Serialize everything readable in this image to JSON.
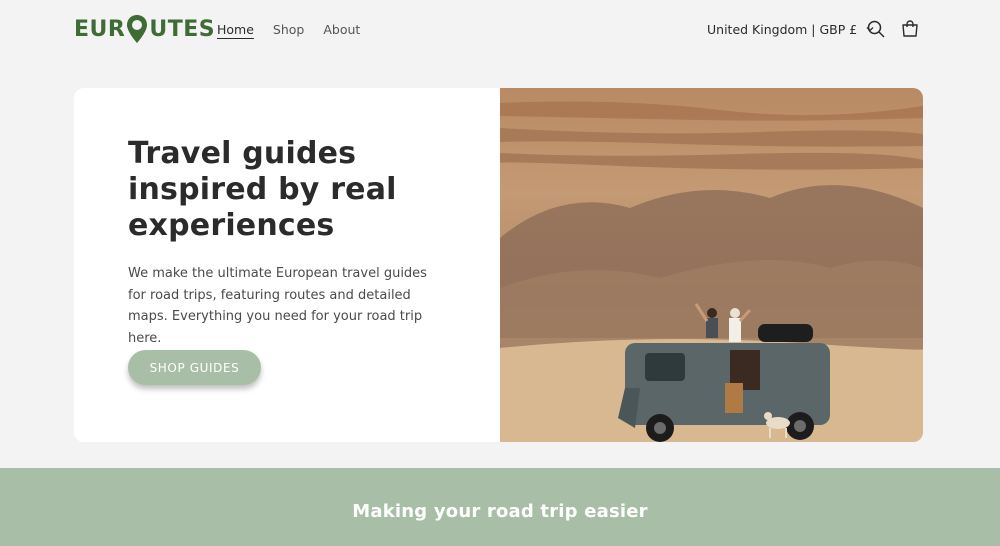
{
  "brand": {
    "logo_left": "EUR",
    "logo_right": "UTES",
    "color": "#3f6b35"
  },
  "nav": {
    "items": [
      {
        "label": "Home",
        "active": true
      },
      {
        "label": "Shop",
        "active": false
      },
      {
        "label": "About",
        "active": false
      }
    ]
  },
  "header": {
    "locale_label": "United Kingdom | GBP £",
    "icons": [
      "chevron-down-icon",
      "search-icon",
      "cart-icon"
    ]
  },
  "hero": {
    "title": "Travel guides inspired by real experiences",
    "description": "We make the ultimate European travel guides for road trips, featuring routes and detailed maps. Everything you need for your road trip here.",
    "cta_label": "SHOP GUIDES",
    "image_description": "van-in-desert-photo"
  },
  "banner": {
    "title": "Making your road trip easier",
    "color": "#a9bea6"
  }
}
